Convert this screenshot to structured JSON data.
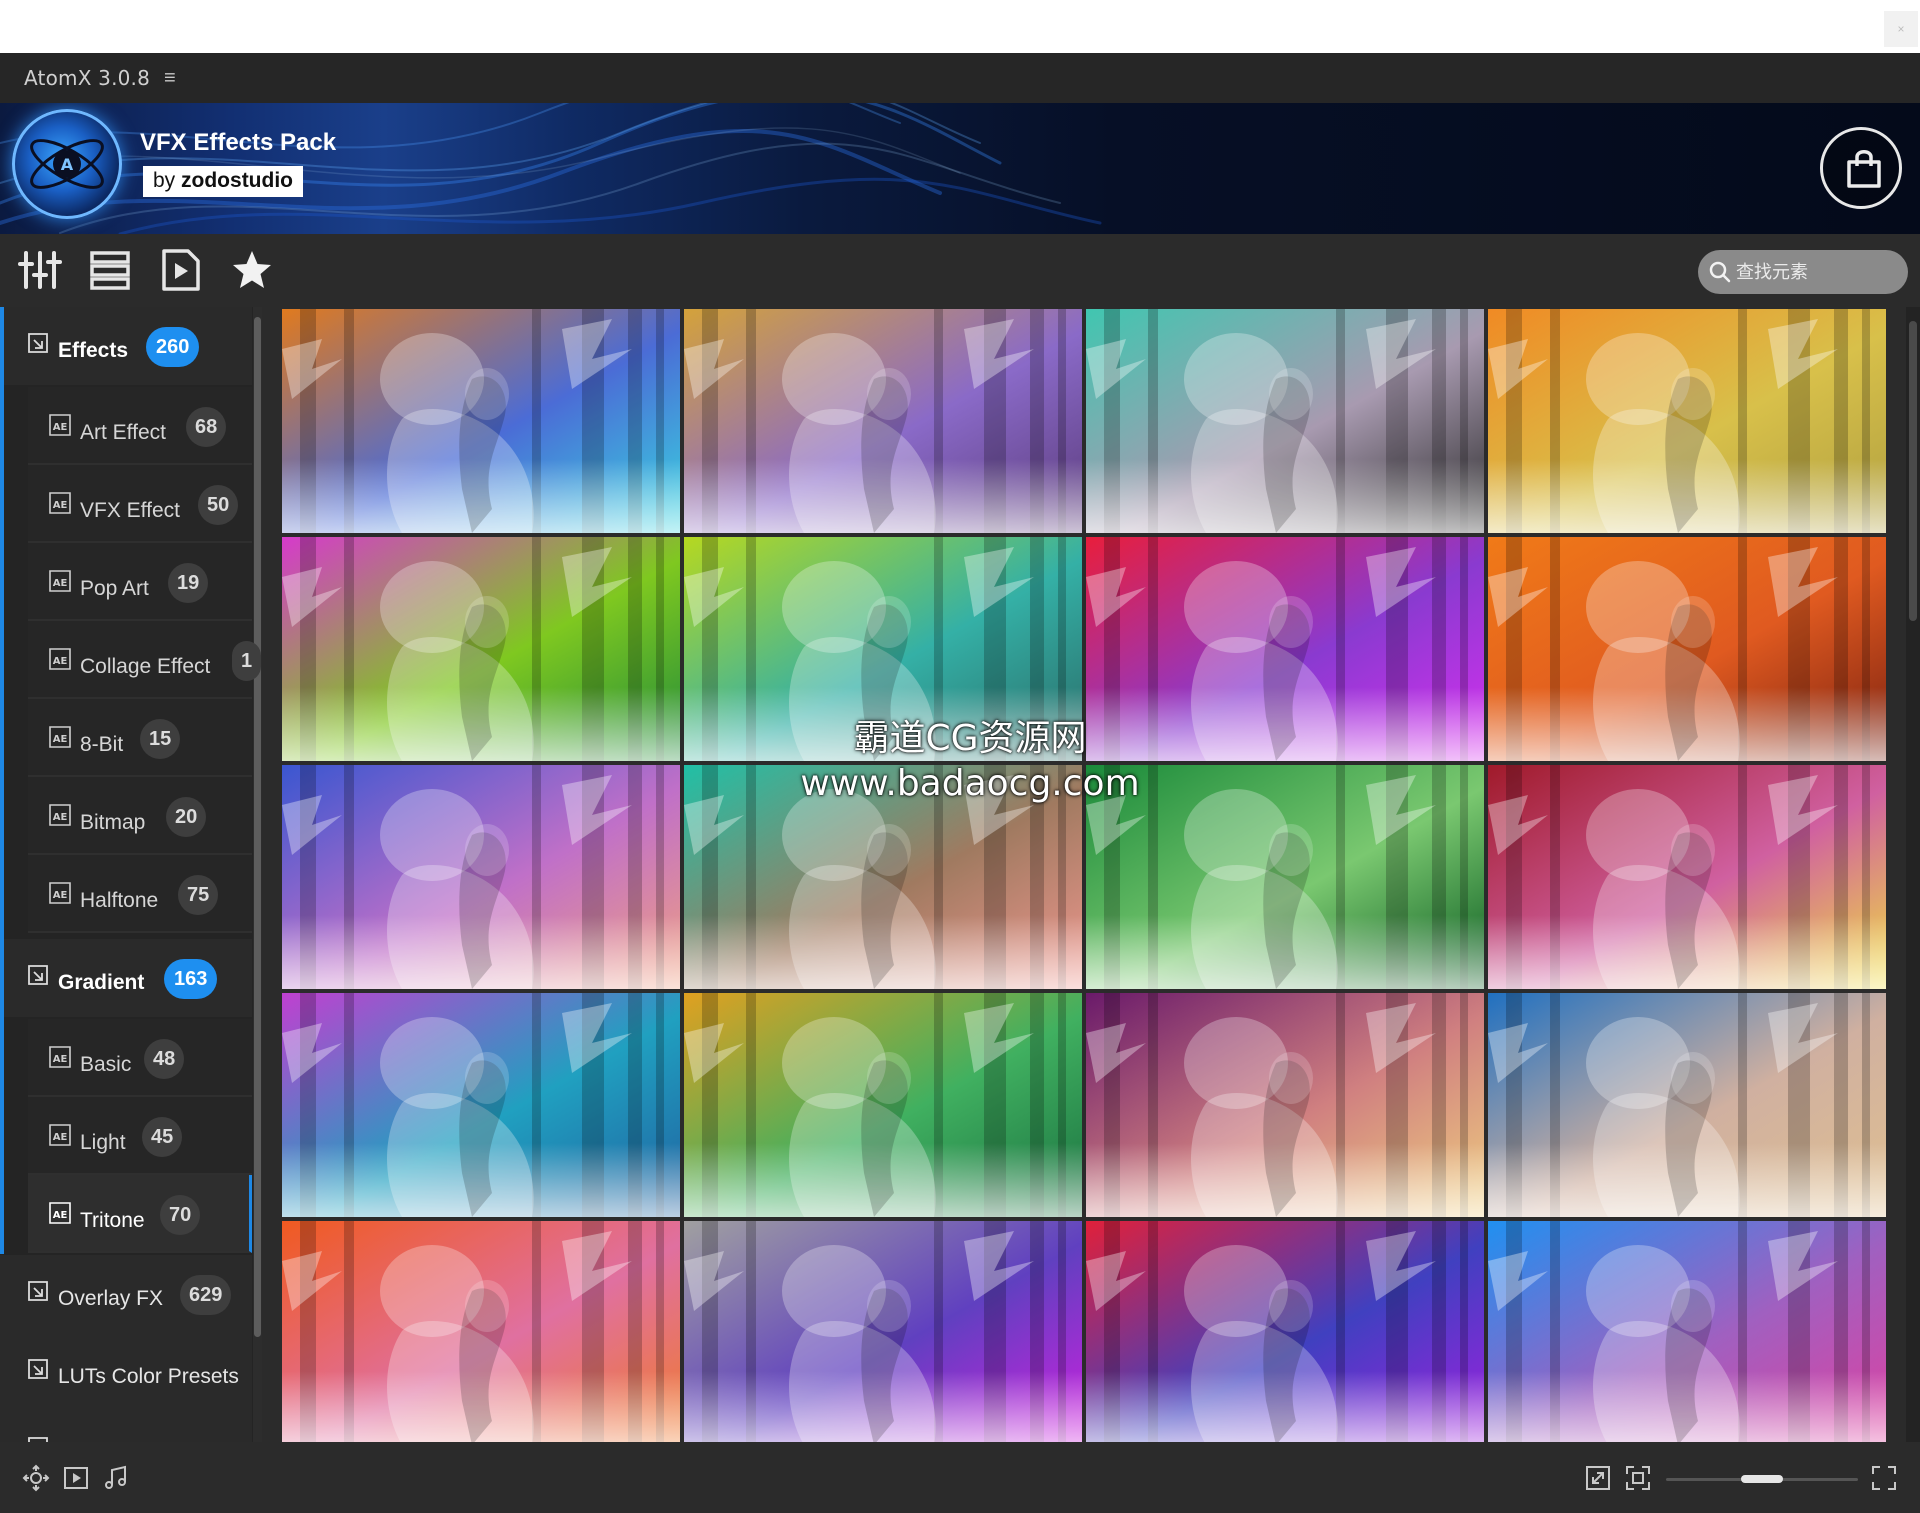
{
  "window": {
    "title": "AtomX 3.0.8",
    "menu_icon": "hamburger-icon",
    "close_label": "×"
  },
  "banner": {
    "pack_title": "VFX Effects Pack",
    "by_prefix": "by",
    "by_author": "zodostudio"
  },
  "toolbar": {
    "tools": [
      "sliders-icon",
      "list-icon",
      "video-file-icon",
      "star-icon"
    ]
  },
  "search": {
    "placeholder": "查找元素"
  },
  "sidebar": {
    "categories": [
      {
        "label": "Effects",
        "count": "260",
        "subs": [
          {
            "label": "Art Effect",
            "count": "68"
          },
          {
            "label": "VFX Effect",
            "count": "50"
          },
          {
            "label": "Pop Art",
            "count": "19"
          },
          {
            "label": "Collage Effect",
            "count": "1"
          },
          {
            "label": "8-Bit",
            "count": "15"
          },
          {
            "label": "Bitmap",
            "count": "20"
          },
          {
            "label": "Halftone",
            "count": "75"
          }
        ]
      },
      {
        "label": "Gradient",
        "count": "163",
        "subs": [
          {
            "label": "Basic",
            "count": "48"
          },
          {
            "label": "Light",
            "count": "45"
          },
          {
            "label": "Tritone",
            "count": "70"
          }
        ]
      },
      {
        "label": "Overlay FX",
        "count": "629"
      },
      {
        "label": "LUTs Color Presets"
      }
    ]
  },
  "grid": {
    "tints": [
      [
        "#e07a1e",
        "#4b6cd6",
        "#38d6e0"
      ],
      [
        "#d4a23a",
        "#8a6ac8",
        "#5a3a7a"
      ],
      [
        "#40c6b0",
        "#a89ab0",
        "#2a2a2a"
      ],
      [
        "#f08a24",
        "#d8c04a",
        "#b0a040"
      ],
      [
        "#d63acb",
        "#7fc820",
        "#1f8a3a"
      ],
      [
        "#b6d820",
        "#34b0a6",
        "#2a6a66"
      ],
      [
        "#e81e3c",
        "#8a3ad0",
        "#d830f0"
      ],
      [
        "#f07a18",
        "#e05a20",
        "#7a2010"
      ],
      [
        "#3a56d0",
        "#c070c8",
        "#f0a080"
      ],
      [
        "#20c0a6",
        "#a07a60",
        "#f09890"
      ],
      [
        "#1a8a3a",
        "#7ac870",
        "#0a5a20"
      ],
      [
        "#a01a2a",
        "#d060a0",
        "#f0e040"
      ],
      [
        "#c040d0",
        "#20a0c0",
        "#2060a0"
      ],
      [
        "#e0a020",
        "#40b060",
        "#1a7040"
      ],
      [
        "#6a1a6a",
        "#d08080",
        "#f0d080"
      ],
      [
        "#2070c0",
        "#d0b0a0",
        "#e0c090"
      ],
      [
        "#f05a20",
        "#e070a0",
        "#f07a2a"
      ],
      [
        "#a0a0a0",
        "#6040c0",
        "#d020e0"
      ],
      [
        "#e0203a",
        "#4040c0",
        "#a020e0"
      ],
      [
        "#2090f0",
        "#a060c0",
        "#e040a0"
      ]
    ]
  },
  "watermark": {
    "line1": "霸道CG资源网",
    "line2": "www.badaocg.com"
  },
  "bottom": {
    "left_icons": [
      "move-icon",
      "play-icon",
      "music-icon"
    ],
    "right_icons": [
      "resize-icon",
      "fit-icon",
      "fullscreen-icon"
    ],
    "zoom_level": 0.5
  }
}
